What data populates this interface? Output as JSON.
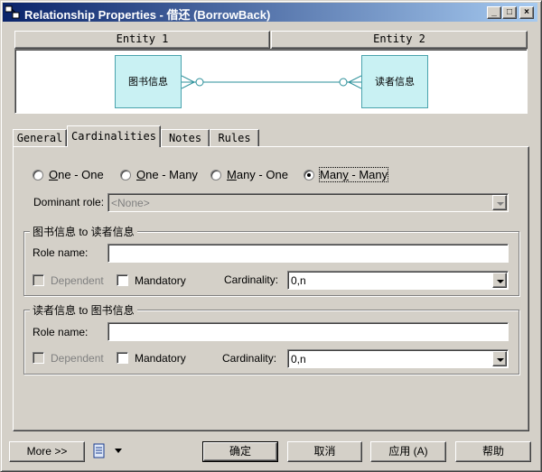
{
  "window": {
    "title": "Relationship Properties - 借还 (BorrowBack)",
    "minimize_glyph": "_",
    "maximize_glyph": "□",
    "close_glyph": "×"
  },
  "entities": {
    "header_left": "Entity 1",
    "header_right": "Entity 2",
    "entity1_name": "图书信息",
    "entity2_name": "读者信息",
    "box_color": "#c9f1f3",
    "line_color": "#2a8f99"
  },
  "tabs": [
    {
      "label": "General"
    },
    {
      "label": "Cardinalities",
      "active": true
    },
    {
      "label": "Notes"
    },
    {
      "label": "Rules"
    }
  ],
  "cardinality_options": [
    {
      "label_pre": "O",
      "label_post": "ne - One",
      "checked": false
    },
    {
      "label_pre": "",
      "label_mid": "O",
      "label_post": "ne - Many",
      "checked": false
    },
    {
      "label_pre": "",
      "label_mid": "M",
      "label_post": "any - One",
      "checked": false
    },
    {
      "label_pre": "Man",
      "label_mid": "y",
      "label_post": " - Many",
      "checked": true
    }
  ],
  "dominant_role": {
    "label": "Dominant role:",
    "value": "<None>"
  },
  "role1": {
    "group_title": "图书信息 to 读者信息",
    "role_name_label": "Role name:",
    "role_name_value": "",
    "dependent_label": "Dependent",
    "mandatory_label": "Mandatory",
    "cardinality_label": "Cardinality:",
    "cardinality_value": "0,n"
  },
  "role2": {
    "group_title": "读者信息 to 图书信息",
    "role_name_label": "Role name:",
    "role_name_value": "",
    "dependent_label": "Dependent",
    "mandatory_label": "Mandatory",
    "cardinality_label": "Cardinality:",
    "cardinality_value": "0,n"
  },
  "footer": {
    "more_label": "More >>",
    "ok_label": "确定",
    "cancel_label": "取消",
    "apply_label": "应用 (A)",
    "help_label": "帮助"
  }
}
